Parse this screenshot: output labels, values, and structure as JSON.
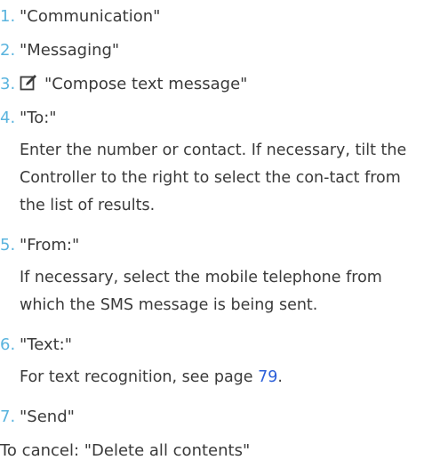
{
  "steps": [
    {
      "number": "1.",
      "label": "\"Communication\""
    },
    {
      "number": "2.",
      "label": "\"Messaging\""
    },
    {
      "number": "3.",
      "label": "\"Compose text message\"",
      "icon": "compose-icon"
    },
    {
      "number": "4.",
      "label": "\"To:\"",
      "description": "Enter the number or contact. If necessary, tilt the Controller to the right to select the con-tact from the list of results."
    },
    {
      "number": "5.",
      "label": "\"From:\"",
      "description": "If necessary, select the mobile telephone from which the SMS message is being sent."
    },
    {
      "number": "6.",
      "label": "\"Text:\"",
      "description_prefix": "For text recognition, see page ",
      "page_ref": "79",
      "description_suffix": "."
    },
    {
      "number": "7.",
      "label": "\"Send\""
    }
  ],
  "cancel_text": "To cancel: \"Delete all contents\"",
  "colors": {
    "step_number": "#5ab4de",
    "page_link": "#2b5fd9",
    "text": "#3a3a3a"
  }
}
